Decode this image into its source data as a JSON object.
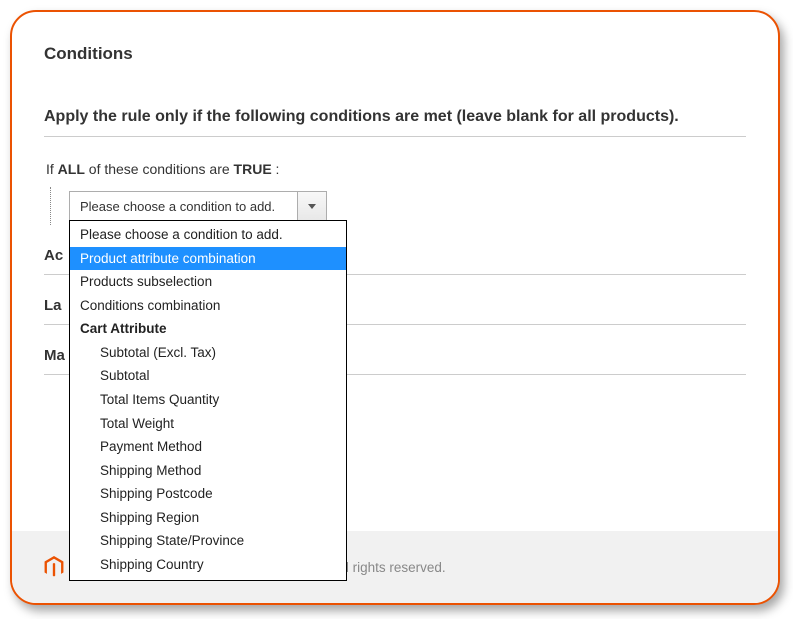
{
  "section_title": "Conditions",
  "instruction": "Apply the rule only if the following conditions are met (leave blank for all products).",
  "rule": {
    "prefix": "If ",
    "aggregator": "ALL",
    "middle": "  of these conditions are ",
    "value": "TRUE",
    "suffix": " :"
  },
  "combo": {
    "selected": "Please choose a condition to add."
  },
  "options": [
    {
      "label": "Please choose a condition to add.",
      "group": false,
      "sub": false,
      "hl": false
    },
    {
      "label": "Product attribute combination",
      "group": false,
      "sub": false,
      "hl": true
    },
    {
      "label": "Products subselection",
      "group": false,
      "sub": false,
      "hl": false
    },
    {
      "label": "Conditions combination",
      "group": false,
      "sub": false,
      "hl": false
    },
    {
      "label": "Cart Attribute",
      "group": true,
      "sub": false,
      "hl": false
    },
    {
      "label": "Subtotal (Excl. Tax)",
      "group": false,
      "sub": true,
      "hl": false
    },
    {
      "label": "Subtotal",
      "group": false,
      "sub": true,
      "hl": false
    },
    {
      "label": "Total Items Quantity",
      "group": false,
      "sub": true,
      "hl": false
    },
    {
      "label": "Total Weight",
      "group": false,
      "sub": true,
      "hl": false
    },
    {
      "label": "Payment Method",
      "group": false,
      "sub": true,
      "hl": false
    },
    {
      "label": "Shipping Method",
      "group": false,
      "sub": true,
      "hl": false
    },
    {
      "label": "Shipping Postcode",
      "group": false,
      "sub": true,
      "hl": false
    },
    {
      "label": "Shipping Region",
      "group": false,
      "sub": true,
      "hl": false
    },
    {
      "label": "Shipping State/Province",
      "group": false,
      "sub": true,
      "hl": false
    },
    {
      "label": "Shipping Country",
      "group": false,
      "sub": true,
      "hl": false
    }
  ],
  "collapsed_sections": [
    "Ac",
    "La",
    "Ma"
  ],
  "footer": {
    "copyright": "Copyright © 2020 Magento Commerce Inc. All rights reserved."
  }
}
